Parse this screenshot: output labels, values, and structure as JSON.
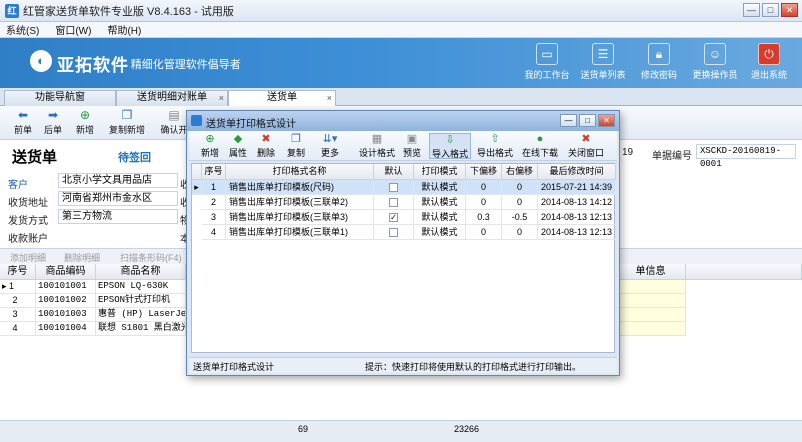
{
  "window": {
    "title": "红管家送货单软件专业版 V8.4.163 - 试用版",
    "app_icon": "app-logo-icon",
    "min": "—",
    "max": "□",
    "close": "✕"
  },
  "menu": [
    "系统(S)",
    "窗口(W)",
    "帮助(H)"
  ],
  "banner": {
    "brand": "亚拓软件",
    "slogan": "· 精细化管理软件倡导者",
    "buttons": [
      {
        "label": "我的工作台",
        "icon": "monitor-icon"
      },
      {
        "label": "送货单列表",
        "icon": "list-icon"
      },
      {
        "label": "修改密码",
        "icon": "lock-icon"
      },
      {
        "label": "更换操作员",
        "icon": "user-icon"
      },
      {
        "label": "退出系统",
        "icon": "power-icon"
      }
    ]
  },
  "tabs": [
    {
      "label": "功能导航窗"
    },
    {
      "label": "送货明细对账单",
      "close": "×"
    },
    {
      "label": "送货单",
      "close": "×"
    }
  ],
  "toolbar": [
    {
      "label": "前单",
      "icon": "arrow-left-icon"
    },
    {
      "label": "后单",
      "icon": "arrow-right-icon"
    },
    {
      "label": "新增",
      "icon": "add-icon"
    },
    {
      "label": "复制新增",
      "icon": "copy-icon"
    },
    {
      "label": "确认开",
      "icon": "confirm-icon"
    }
  ],
  "document": {
    "title": "送货单",
    "status": "待签回",
    "customer_label": "客户",
    "customer": "北京小学文具用品店",
    "address_label": "收货地址",
    "address": "河南省郑州市金水区",
    "ship_label": "发货方式",
    "ship": "第三方物流",
    "account_label": "收款账户",
    "date_fragment": "19",
    "docno_label": "单据编号",
    "docno": "XSCKD-20160819-0001",
    "hidden_frag": [
      "收",
      "收",
      "物",
      "本"
    ]
  },
  "grid_tools": [
    "添加明细",
    "删除明细",
    "扫描条形码(F4)"
  ],
  "grid": {
    "headers": [
      "序号",
      "商品编码",
      "商品名称",
      "单信息"
    ],
    "rows": [
      {
        "no": "1",
        "marker": "▸",
        "code": "100101001",
        "name": "EPSON LQ-630K"
      },
      {
        "no": "2",
        "marker": "",
        "code": "100101002",
        "name": "EPSON针式打印机"
      },
      {
        "no": "3",
        "marker": "",
        "code": "100101003",
        "name": "惠普 (HP) LaserJet"
      },
      {
        "no": "4",
        "marker": "",
        "code": "100101004",
        "name": "联想 S1801 黑白激光"
      }
    ]
  },
  "statusbar": {
    "val1": "69",
    "val2": "23266"
  },
  "modal": {
    "title": "送货单打印格式设计",
    "toolbar": [
      {
        "label": "新增",
        "icon": "add-icon"
      },
      {
        "label": "属性",
        "icon": "properties-icon"
      },
      {
        "label": "删除",
        "icon": "delete-icon"
      },
      {
        "label": "复制",
        "icon": "copy-icon"
      },
      {
        "label": "更多",
        "icon": "more-icon"
      },
      {
        "label": "设计格式",
        "icon": "design-icon"
      },
      {
        "label": "预览",
        "icon": "preview-icon"
      },
      {
        "label": "导入格式",
        "icon": "import-icon"
      },
      {
        "label": "导出格式",
        "icon": "export-icon"
      },
      {
        "label": "在线下载",
        "icon": "download-icon"
      },
      {
        "label": "关闭窗口",
        "icon": "close-window-icon"
      }
    ],
    "headers": [
      "序号",
      "打印格式名称",
      "默认",
      "打印模式",
      "下偏移",
      "右偏移",
      "最后修改时间"
    ],
    "rows": [
      {
        "no": "1",
        "name": "销售出库单打印模板(尺码)",
        "default": false,
        "mode": "默认模式",
        "down": "0",
        "right": "0",
        "time": "2015-07-21 14:39"
      },
      {
        "no": "2",
        "name": "销售出库单打印模板(三联单2)",
        "default": false,
        "mode": "默认模式",
        "down": "0",
        "right": "0",
        "time": "2014-08-13 14:12"
      },
      {
        "no": "3",
        "name": "销售出库单打印模板(三联单3)",
        "default": true,
        "mode": "默认模式",
        "down": "0.3",
        "right": "-0.5",
        "time": "2014-08-13 12:13"
      },
      {
        "no": "4",
        "name": "销售出库单打印模板(三联单1)",
        "default": false,
        "mode": "默认模式",
        "down": "0",
        "right": "0",
        "time": "2014-08-13 12:13"
      }
    ],
    "status_left": "送货单打印格式设计",
    "status_right": "提示：快速打印将使用默认的打印格式进行打印输出。"
  }
}
